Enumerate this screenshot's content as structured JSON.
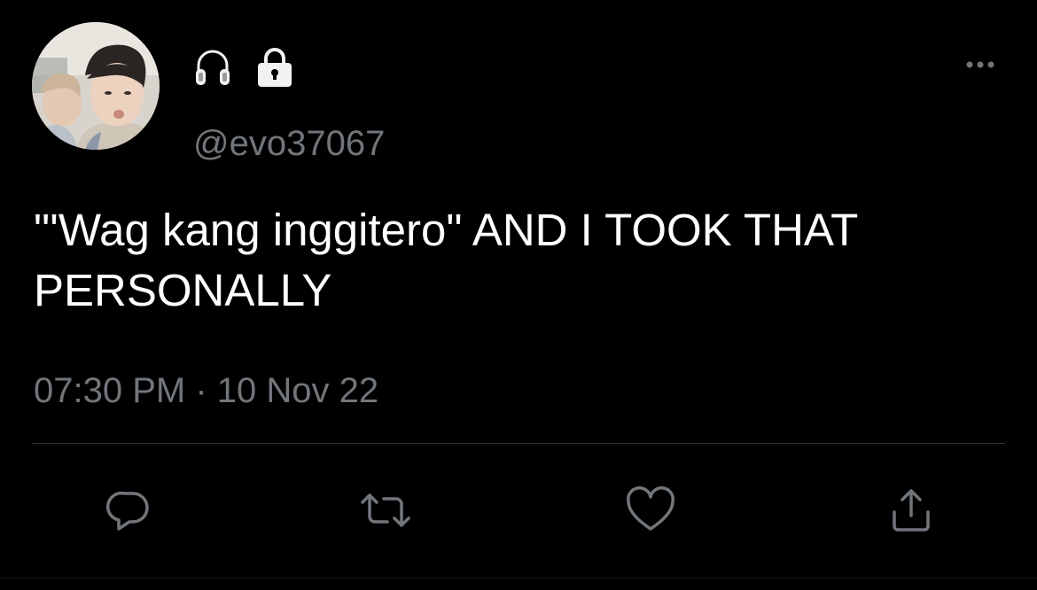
{
  "user": {
    "handle": "@evo37067",
    "name_icons": [
      "headphones-icon",
      "lock-icon"
    ]
  },
  "tweet": {
    "text": "\"'Wag kang inggitero\" AND I TOOK THAT PERSONALLY",
    "time": "07:30 PM",
    "separator": "·",
    "date": "10 Nov 22"
  },
  "actions": [
    "reply-icon",
    "retweet-icon",
    "like-icon",
    "share-icon"
  ],
  "colors": {
    "background": "#000000",
    "text_primary": "#ffffff",
    "text_secondary": "#71767b",
    "divider": "#2f3336"
  }
}
